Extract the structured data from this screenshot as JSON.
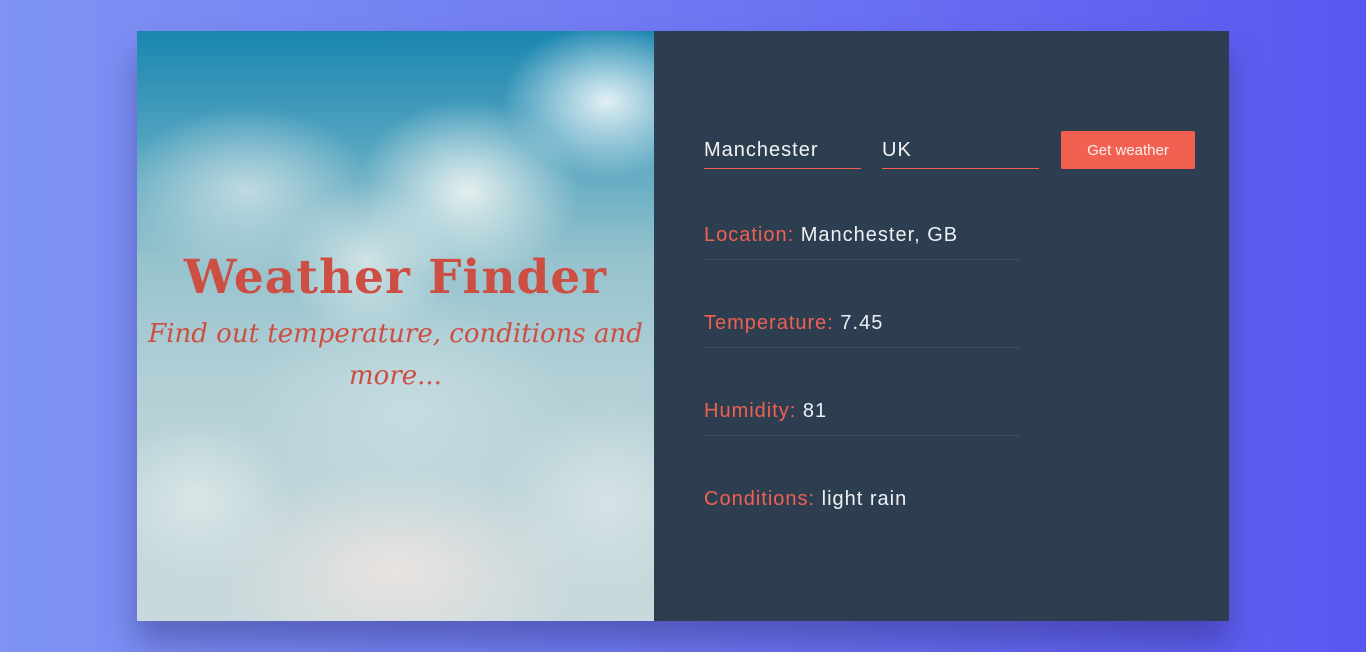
{
  "hero": {
    "title": "Weather Finder",
    "subtitle": "Find out temperature, conditions and more..."
  },
  "form": {
    "city_value": "Manchester",
    "country_value": "UK",
    "submit_label": "Get weather"
  },
  "results": [
    {
      "label": "Location:",
      "value": "Manchester, GB"
    },
    {
      "label": "Temperature:",
      "value": "7.45"
    },
    {
      "label": "Humidity:",
      "value": "81"
    },
    {
      "label": "Conditions:",
      "value": "light rain"
    }
  ],
  "colors": {
    "accent": "#f16051",
    "panel_bg": "#2c3e50",
    "title": "#cd4e42"
  }
}
